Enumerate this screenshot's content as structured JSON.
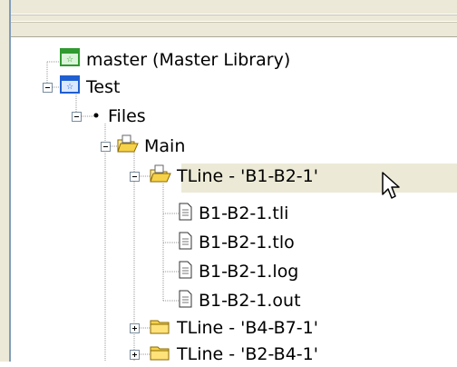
{
  "tree": {
    "master": "master (Master Library)",
    "test": "Test",
    "files": "Files",
    "main": "Main",
    "tline1": "TLine - 'B1-B2-1'",
    "f_tli": "B1-B2-1.tli",
    "f_tlo": "B1-B2-1.tlo",
    "f_log": "B1-B2-1.log",
    "f_out": "B1-B2-1.out",
    "tline2": "TLine - 'B4-B7-1'",
    "tline3": "TLine - 'B2-B4-1'"
  },
  "colors": {
    "hover_row": "#ecead6",
    "tree_lines": "#9a9a9a",
    "library_icon_green": "#2f9a2f",
    "library_icon_blue": "#1f5fd0",
    "folder_yellow": "#f6d24a"
  },
  "icons": [
    "library-icon",
    "project-icon",
    "dot-icon",
    "open-folder-icon",
    "document-icon",
    "folder-icon",
    "mouse-cursor-icon"
  ]
}
